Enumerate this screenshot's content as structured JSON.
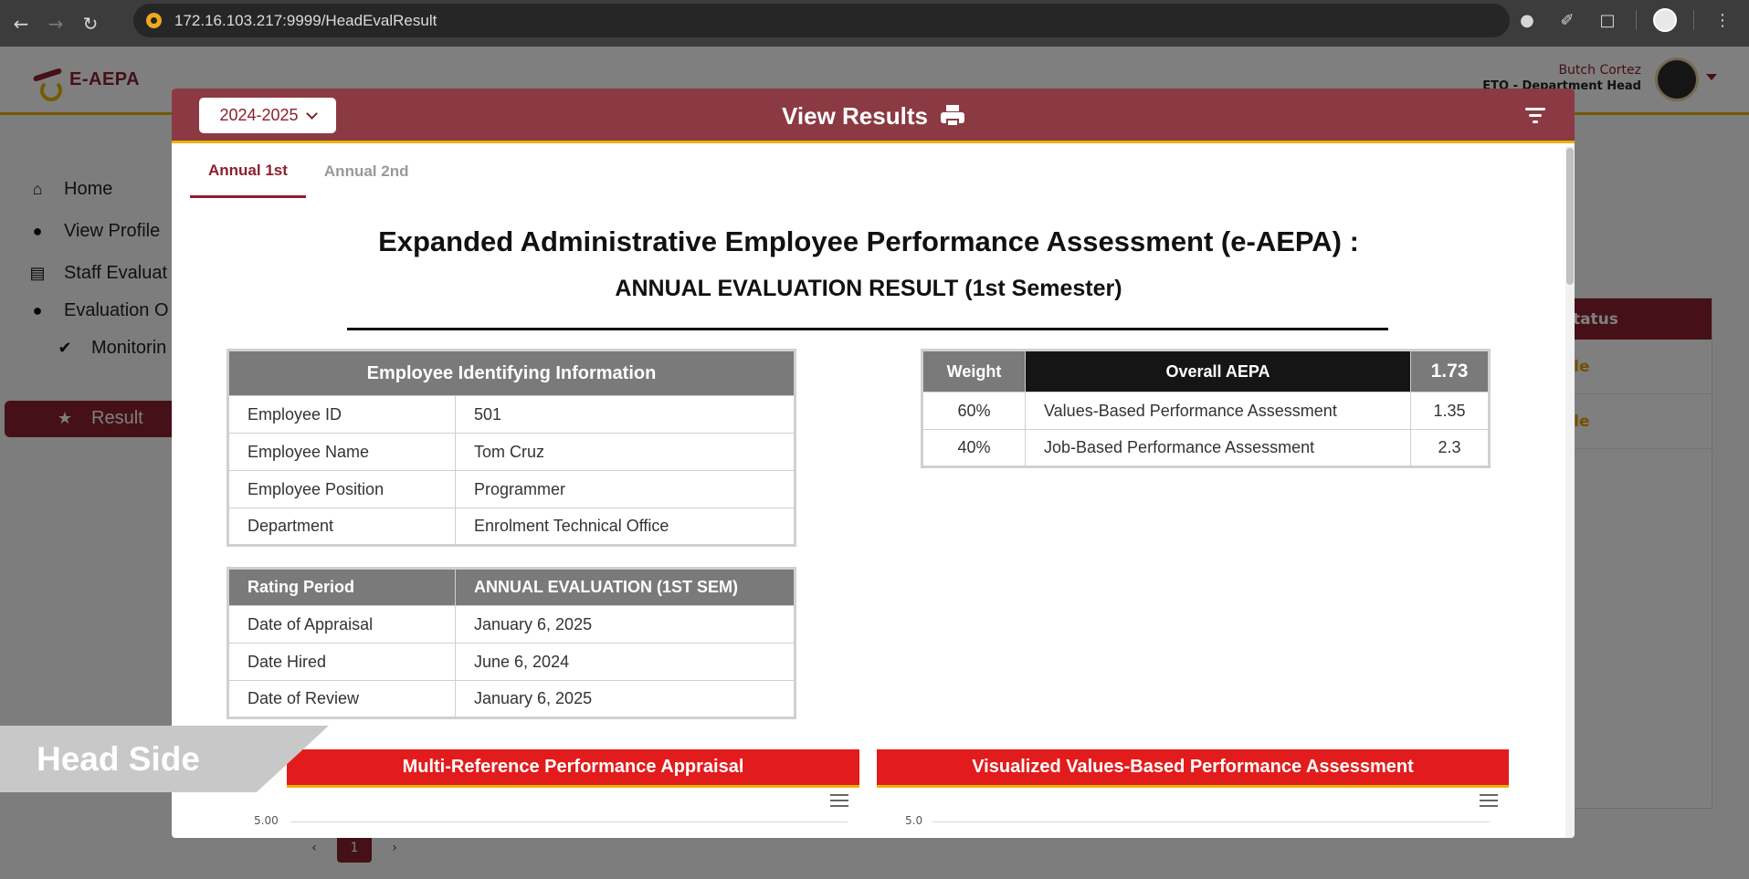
{
  "browser": {
    "url": "172.16.103.217:9999/HeadEvalResult"
  },
  "app": {
    "logo_text": "E-AEPA",
    "user": {
      "name": "Butch Cortez",
      "role": "ETO - Department Head"
    },
    "sidebar": {
      "items": [
        {
          "label": "Home",
          "icon": "home-icon"
        },
        {
          "label": "View Profile",
          "icon": "person-icon"
        },
        {
          "label": "Staff Evaluat",
          "icon": "document-icon"
        },
        {
          "label": "Evaluation O",
          "icon": "person-icon"
        },
        {
          "label": "Monitorin",
          "icon": "user-check-icon"
        },
        {
          "label": "Result",
          "icon": "star-icon"
        }
      ]
    },
    "status_card": {
      "header": ": Status",
      "rows": [
        "ble",
        "ble"
      ]
    },
    "pager": {
      "prev": "‹",
      "current": "1",
      "next": "›"
    }
  },
  "modal": {
    "year": "2024-2025",
    "title": "View Results",
    "tabs": [
      {
        "label": "Annual 1st",
        "active": true
      },
      {
        "label": "Annual 2nd",
        "active": false
      }
    ],
    "main_title": "Expanded Administrative Employee Performance Assessment (e-AEPA) :",
    "sub_title": "ANNUAL EVALUATION RESULT (1st Semester)",
    "employee_info": {
      "header": "Employee Identifying Information",
      "rows": [
        {
          "label": "Employee ID",
          "value": "501"
        },
        {
          "label": "Employee Name",
          "value": "Tom Cruz"
        },
        {
          "label": "Employee Position",
          "value": "Programmer"
        },
        {
          "label": "Department",
          "value": "Enrolment Technical Office"
        }
      ]
    },
    "rating_period": {
      "label": "Rating Period",
      "value": "ANNUAL EVALUATION (1ST SEM)",
      "rows": [
        {
          "label": "Date of Appraisal",
          "value": "January 6, 2025"
        },
        {
          "label": "Date Hired",
          "value": "June 6, 2024"
        },
        {
          "label": "Date of Review",
          "value": "January 6, 2025"
        }
      ]
    },
    "overall": {
      "weight_header": "Weight",
      "title": "Overall AEPA",
      "score": "1.73",
      "rows": [
        {
          "weight": "60%",
          "desc": "Values-Based Performance Assessment",
          "score": "1.35"
        },
        {
          "weight": "40%",
          "desc": "Job-Based Performance Assessment",
          "score": "2.3"
        }
      ]
    },
    "sections": {
      "left_title": "Multi-Reference Performance Appraisal",
      "right_title": "Visualized Values-Based Performance Assessment",
      "left_axis_top": "5.00",
      "right_axis_top": "5.0"
    }
  },
  "watermark": {
    "label": "Head Side"
  },
  "colors": {
    "brand": "#8b2030",
    "header_bar": "#8b3a43",
    "accent": "#e8b400",
    "section_red": "#e21c1c",
    "table_header": "#7a7a7a"
  }
}
